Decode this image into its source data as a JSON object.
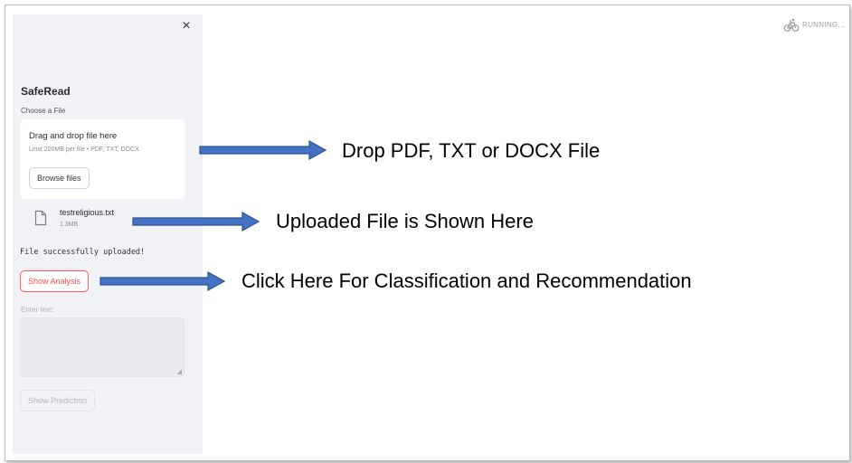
{
  "sidebar": {
    "close_label": "×",
    "app_title": "SafeRead",
    "choose_file_label": "Choose a File",
    "dropzone": {
      "title": "Drag and drop file here",
      "limit": "Limit 200MB per file • PDF, TXT, DOCX",
      "browse_label": "Browse files"
    },
    "uploaded_file": {
      "name": "testreligious.txt",
      "size": "1.3MB",
      "icon": "file-icon"
    },
    "success_message": "File successfully uploaded!",
    "show_analysis_label": "Show Analysis",
    "enter_text_label": "Enter text:",
    "text_value": "",
    "show_prediction_label": "Show Prediction"
  },
  "status": {
    "icon": "bicycle-icon",
    "text": "RUNNING..."
  },
  "callouts": [
    {
      "text": "Drop PDF, TXT or DOCX File"
    },
    {
      "text": "Uploaded File is Shown Here"
    },
    {
      "text": "Click Here For Classification and Recommendation"
    }
  ],
  "colors": {
    "sidebar_bg": "#f0f2f6",
    "accent_red": "#ff4b4b",
    "arrow_fill": "#4472c4",
    "arrow_stroke": "#2f528f"
  }
}
